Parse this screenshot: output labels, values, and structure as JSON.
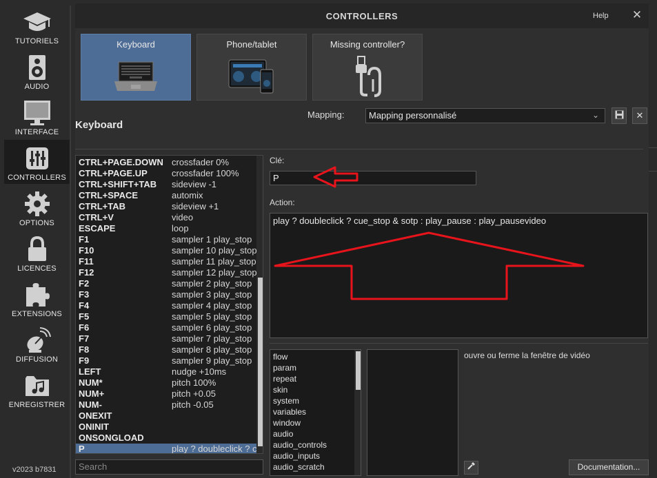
{
  "sidebar": {
    "items": [
      {
        "label": "TUTORIELS",
        "icon": "graduation-cap-icon"
      },
      {
        "label": "AUDIO",
        "icon": "speaker-icon"
      },
      {
        "label": "INTERFACE",
        "icon": "monitor-icon"
      },
      {
        "label": "CONTROLLERS",
        "icon": "sliders-icon",
        "active": true
      },
      {
        "label": "OPTIONS",
        "icon": "gear-icon"
      },
      {
        "label": "LICENCES",
        "icon": "lock-icon"
      },
      {
        "label": "EXTENSIONS",
        "icon": "puzzle-icon"
      },
      {
        "label": "DIFFUSION",
        "icon": "satellite-dish-icon"
      },
      {
        "label": "ENREGISTRER",
        "icon": "folder-music-icon"
      }
    ],
    "version": "v2023 b7831"
  },
  "window": {
    "title": "CONTROLLERS",
    "help": "Help",
    "close": "✕"
  },
  "tiles": [
    {
      "label": "Keyboard",
      "active": true
    },
    {
      "label": "Phone/tablet"
    },
    {
      "label": "Missing controller?"
    }
  ],
  "mapping": {
    "label": "Mapping:",
    "value": "Mapping personnalisé",
    "save_icon": "floppy-icon",
    "delete": "✕"
  },
  "section_title": "Keyboard",
  "keys": [
    {
      "key": "CTRL+PAGE.DOWN",
      "action": "crossfader 0%"
    },
    {
      "key": "CTRL+PAGE.UP",
      "action": "crossfader 100%"
    },
    {
      "key": "CTRL+SHIFT+TAB",
      "action": "sideview -1"
    },
    {
      "key": "CTRL+SPACE",
      "action": "automix"
    },
    {
      "key": "CTRL+TAB",
      "action": "sideview +1"
    },
    {
      "key": "CTRL+V",
      "action": "video"
    },
    {
      "key": "ESCAPE",
      "action": "loop"
    },
    {
      "key": "F1",
      "action": "sampler 1 play_stop"
    },
    {
      "key": "F10",
      "action": "sampler 10 play_stop"
    },
    {
      "key": "F11",
      "action": "sampler 11 play_stop"
    },
    {
      "key": "F12",
      "action": "sampler 12 play_stop"
    },
    {
      "key": "F2",
      "action": "sampler 2 play_stop"
    },
    {
      "key": "F3",
      "action": "sampler 3 play_stop"
    },
    {
      "key": "F4",
      "action": "sampler 4 play_stop"
    },
    {
      "key": "F5",
      "action": "sampler 5 play_stop"
    },
    {
      "key": "F6",
      "action": "sampler 6 play_stop"
    },
    {
      "key": "F7",
      "action": "sampler 7 play_stop"
    },
    {
      "key": "F8",
      "action": "sampler 8 play_stop"
    },
    {
      "key": "F9",
      "action": "sampler 9 play_stop"
    },
    {
      "key": "LEFT",
      "action": "nudge +10ms"
    },
    {
      "key": "NUM*",
      "action": "pitch 100%"
    },
    {
      "key": "NUM+",
      "action": "pitch +0.05"
    },
    {
      "key": "NUM-",
      "action": "pitch -0.05"
    },
    {
      "key": "ONEXIT",
      "action": ""
    },
    {
      "key": "ONINIT",
      "action": ""
    },
    {
      "key": "ONSONGLOAD",
      "action": ""
    },
    {
      "key": "P",
      "action": "play ? doubleclick ? cue_stop & sotp : play_pause : play_pausevideo",
      "selected": true
    }
  ],
  "search_placeholder": "Search",
  "cle": {
    "label": "Clé:",
    "value": "P"
  },
  "action": {
    "label": "Action:",
    "value": "play ? doubleclick ? cue_stop & sotp : play_pause : play_pausevideo"
  },
  "verbs": [
    "flow",
    "param",
    "repeat",
    "skin",
    "system",
    "variables",
    "window",
    "audio",
    "audio_controls",
    "audio_inputs",
    "audio_scratch"
  ],
  "description": "ouvre ou ferme la fenêtre de vidéo",
  "documentation": "Documentation...",
  "colors": {
    "accent": "#4e6d96",
    "annotation": "#e8141c"
  }
}
